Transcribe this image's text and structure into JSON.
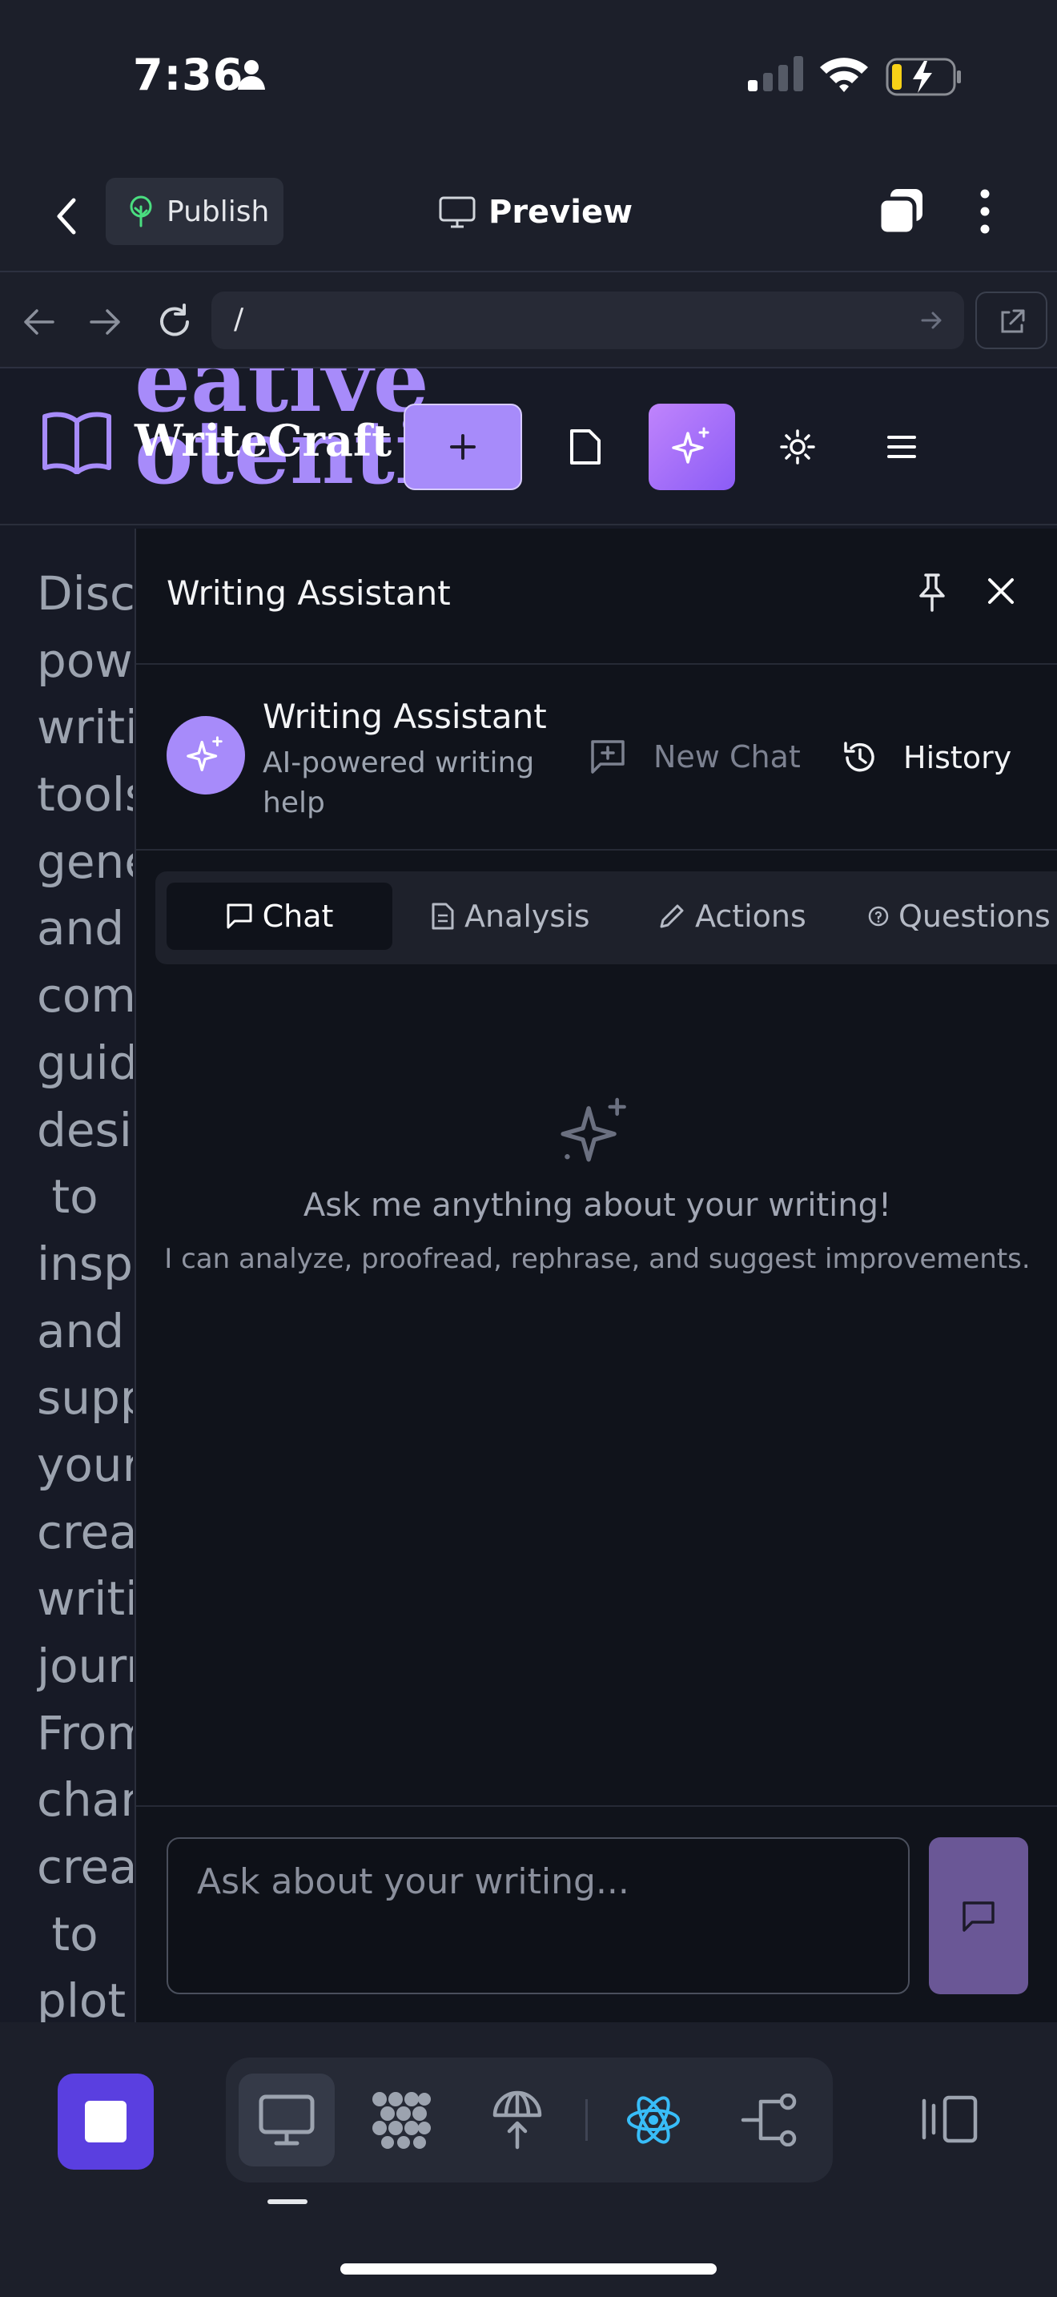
{
  "status_bar": {
    "time": "7:36",
    "icons": [
      "person-icon",
      "signal-icon",
      "wifi-icon",
      "battery-charging-icon"
    ]
  },
  "toolbar": {
    "back_icon": "chevron-left-icon",
    "publish_label": "Publish",
    "publish_icon": "tree-icon",
    "preview_label": "Preview",
    "preview_icon": "monitor-icon",
    "right_icons": [
      "tabs-icon",
      "more-vertical-icon"
    ]
  },
  "browser": {
    "url": "/",
    "icons": [
      "back-arrow-icon",
      "forward-arrow-icon",
      "reload-icon",
      "go-arrow-icon",
      "external-link-icon"
    ]
  },
  "site": {
    "brand_name": "WriteCraft",
    "hero_fragment_line1": "eative",
    "hero_fragment_line2": "otential",
    "header_icons": [
      "book-icon",
      "plus-icon",
      "document-icon",
      "sparkles-icon",
      "sun-icon",
      "menu-icon"
    ],
    "body_text_lines": [
      "Disc",
      "pow",
      "writi",
      "tools",
      "gene",
      "and",
      "com",
      "guid",
      "desig",
      " to",
      "insp",
      "and",
      "supp",
      "your",
      "crea",
      "writi",
      "journ",
      "From",
      "char",
      "crea",
      " to",
      "plot"
    ]
  },
  "assistant": {
    "panel_title": "Writing Assistant",
    "panel_icons": [
      "pin-icon",
      "close-icon"
    ],
    "info_title": "Writing Assistant",
    "info_subtitle": "AI-powered writing help",
    "new_chat_label": "New Chat",
    "history_label": "History",
    "tabs": [
      {
        "label": "Chat",
        "icon": "message-square-icon",
        "active": true
      },
      {
        "label": "Analysis",
        "icon": "file-text-icon",
        "active": false
      },
      {
        "label": "Actions",
        "icon": "pencil-icon",
        "active": false
      },
      {
        "label": "Questions",
        "icon": "help-circle-icon",
        "active": false
      }
    ],
    "empty_title": "Ask me anything about your writing!",
    "empty_subtitle": "I can analyze, proofread, rephrase, and suggest improvements.",
    "input_placeholder": "Ask about your writing...",
    "send_icon": "message-square-icon"
  },
  "dock": {
    "stop_icon": "stop-icon",
    "items": [
      "monitor-icon",
      "dots-grid-icon",
      "deploy-icon",
      "react-icon",
      "flow-icon"
    ],
    "active_item": "monitor-icon",
    "right_icon": "panel-toggle-icon"
  },
  "colors": {
    "accent": "#a78bfa",
    "stop_button": "#5a3fe0",
    "react": "#38bdf8",
    "panel_bg": "#10131b",
    "app_bg": "#1c1f2a"
  }
}
